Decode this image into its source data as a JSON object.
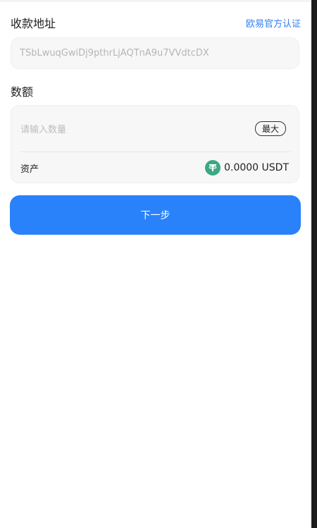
{
  "address_section": {
    "label": "收款地址",
    "link": "欧易官方认证",
    "value": "TSbLwuqGwiDj9pthrLjAQTnA9u7VVdtcDX"
  },
  "amount_section": {
    "label": "数额",
    "placeholder": "请输入数量",
    "max_label": "最大",
    "asset_label": "资产",
    "asset_value": "0.0000 USDT",
    "asset_icon": "usdt-icon",
    "asset_icon_color": "#3aa883"
  },
  "next_button": {
    "label": "下一步",
    "color": "#2a82fb"
  },
  "colors": {
    "accent": "#2d7ef7"
  }
}
